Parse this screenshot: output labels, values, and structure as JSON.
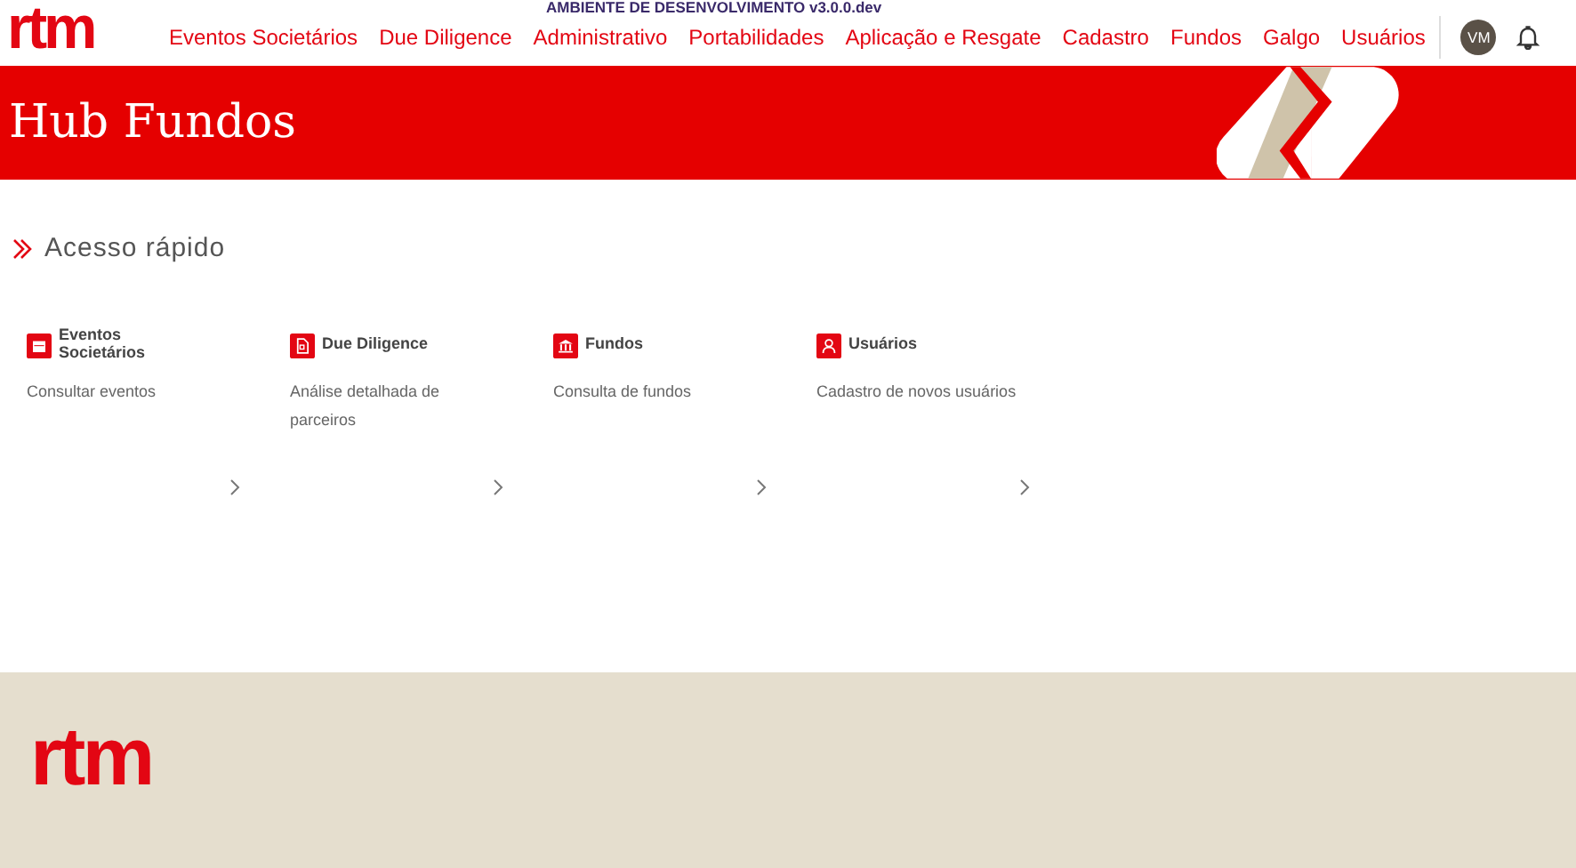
{
  "header": {
    "logo": "rtm",
    "environment": "AMBIENTE DE DESENVOLVIMENTO v3.0.0.dev",
    "nav": [
      "Eventos Societários",
      "Due Diligence",
      "Administrativo",
      "Portabilidades",
      "Aplicação e Resgate",
      "Cadastro",
      "Fundos",
      "Galgo",
      "Usuários"
    ],
    "avatar": "VM"
  },
  "banner": {
    "title": "Hub Fundos"
  },
  "quick_access": {
    "title": "Acesso rápido",
    "cards": [
      {
        "kind": "calendar",
        "title": "Eventos Societários",
        "description": "Consultar eventos"
      },
      {
        "kind": "document",
        "title": "Due Diligence",
        "description": "Análise detalhada de parceiros"
      },
      {
        "kind": "bank",
        "title": "Fundos",
        "description": "Consulta de fundos"
      },
      {
        "kind": "user",
        "title": "Usuários",
        "description": "Cadastro de novos usuários"
      }
    ]
  },
  "footer": {
    "logo": "rtm"
  }
}
